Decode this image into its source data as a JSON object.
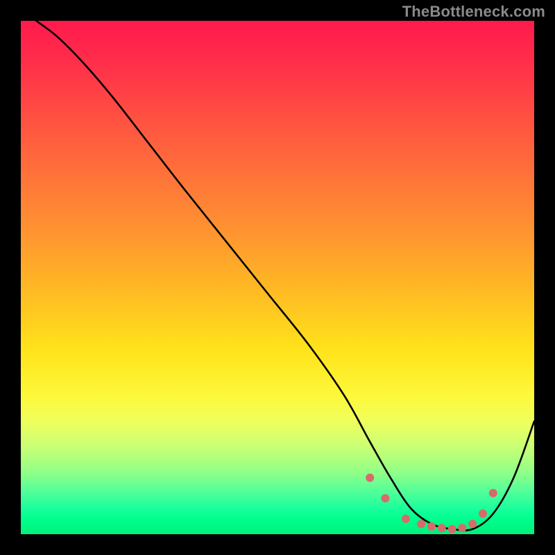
{
  "watermark": "TheBottleneck.com",
  "chart_data": {
    "type": "line",
    "title": "",
    "xlabel": "",
    "ylabel": "",
    "xlim": [
      0,
      100
    ],
    "ylim": [
      0,
      100
    ],
    "grid": false,
    "legend": false,
    "background_gradient_top_color": "#ff1a4d",
    "background_gradient_bottom_color": "#00f07a",
    "series": [
      {
        "name": "bottleneck-curve",
        "color": "#000000",
        "x": [
          3,
          7,
          12,
          18,
          25,
          32,
          40,
          48,
          56,
          63,
          68,
          72,
          76,
          80,
          84,
          88,
          92,
          96,
          100
        ],
        "y": [
          100,
          97,
          92,
          85,
          76,
          67,
          57,
          47,
          37,
          27,
          18,
          11,
          5,
          2,
          1,
          1,
          4,
          11,
          22
        ]
      }
    ],
    "markers": {
      "name": "highlight-dots",
      "color": "#d86a6a",
      "radius_px": 6,
      "x": [
        68,
        71,
        75,
        78,
        80,
        82,
        84,
        86,
        88,
        90,
        92
      ],
      "y": [
        11,
        7,
        3,
        2,
        1.5,
        1.2,
        1,
        1.2,
        2,
        4,
        8
      ]
    }
  }
}
